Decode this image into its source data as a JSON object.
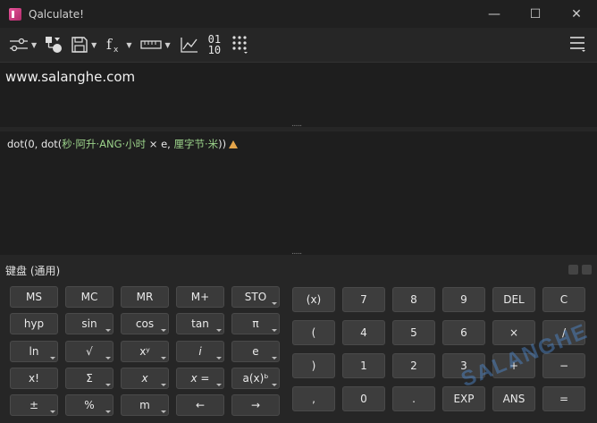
{
  "window": {
    "title": "Qalculate!",
    "minimize_glyph": "—",
    "maximize_glyph": "☐",
    "close_glyph": "✕"
  },
  "toolbar": {
    "number_bases_text_top": "01",
    "number_bases_text_bottom": "10"
  },
  "expression": {
    "text": "www.salanghe.com"
  },
  "result": {
    "part1": "dot(0, dot(",
    "part2": "秒·阿升·ANG·小时",
    "part3": " × e, ",
    "part4": "厘字节·米",
    "part5": "))"
  },
  "keypad": {
    "title": "键盘 (通用)",
    "left_keys": [
      [
        "MS",
        "MC",
        "MR",
        "M+",
        "STO"
      ],
      [
        "hyp",
        "sin",
        "cos",
        "tan",
        "π"
      ],
      [
        "ln",
        "√",
        "xʸ",
        "i",
        "e"
      ],
      [
        "x!",
        "Σ",
        "x",
        "x =",
        "a(x)ᵇ"
      ],
      [
        "±",
        "%",
        "m",
        "←",
        "→"
      ]
    ],
    "right_keys": [
      [
        "(x)",
        "7",
        "8",
        "9",
        "DEL",
        "C"
      ],
      [
        "(",
        "4",
        "5",
        "6",
        "×",
        "/"
      ],
      [
        ")",
        "1",
        "2",
        "3",
        "+",
        "−"
      ],
      [
        ",",
        "0",
        ".",
        "EXP",
        "ANS",
        "="
      ]
    ]
  },
  "watermark": "SALANGHE"
}
